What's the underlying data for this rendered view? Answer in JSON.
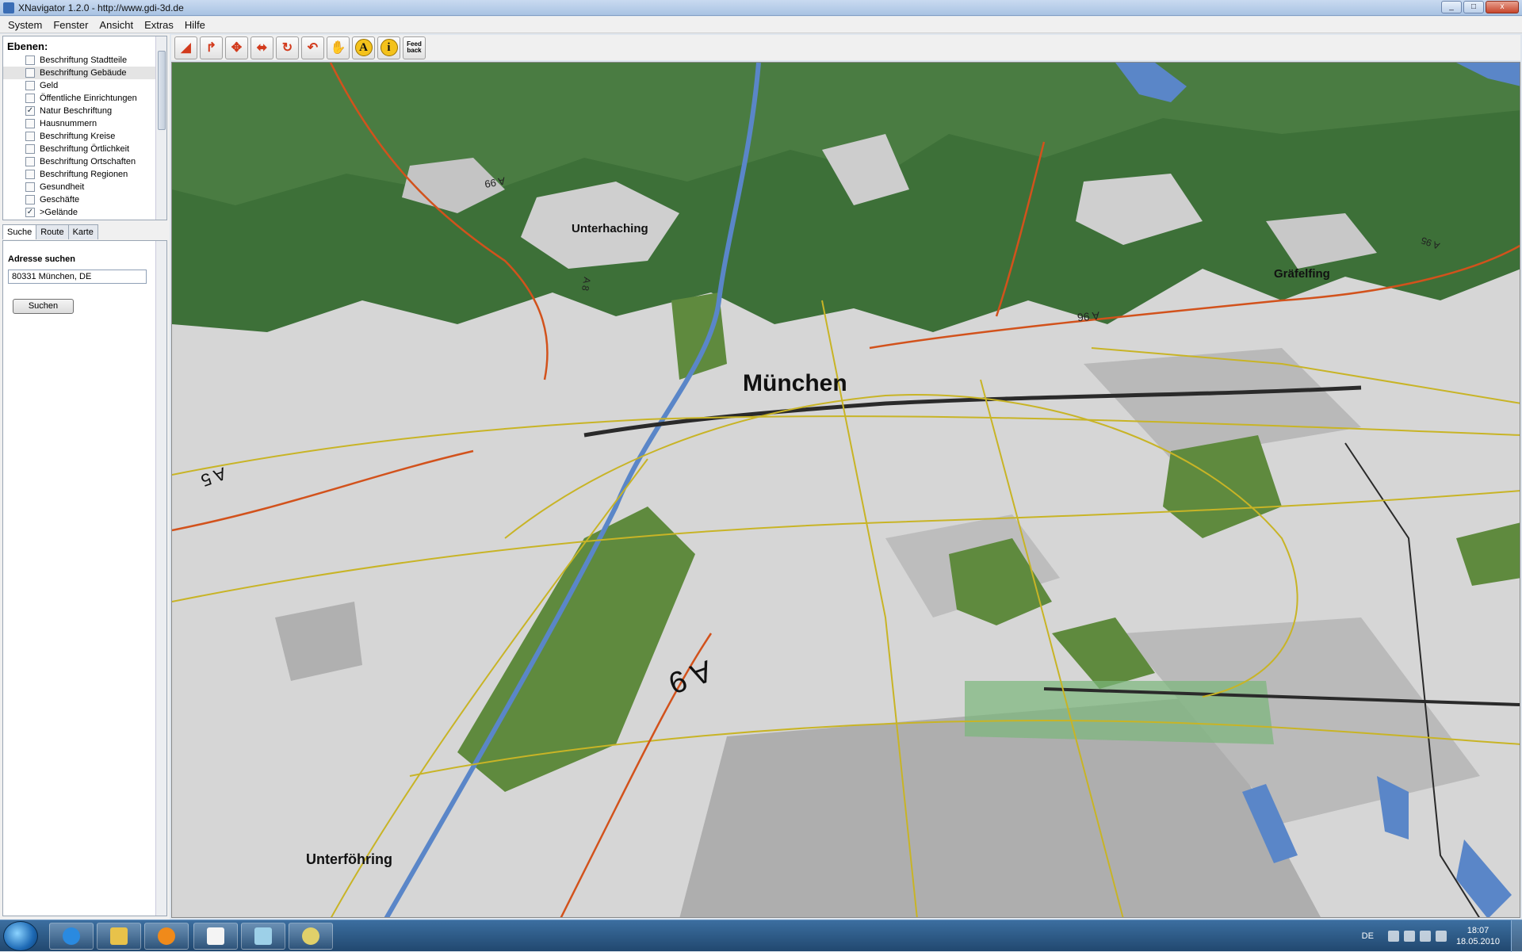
{
  "window": {
    "title": "XNavigator 1.2.0 - http://www.gdi-3d.de"
  },
  "menu": [
    "System",
    "Fenster",
    "Ansicht",
    "Extras",
    "Hilfe"
  ],
  "layers": {
    "heading": "Ebenen:",
    "items": [
      {
        "label": "Beschriftung Stadtteile",
        "checked": false
      },
      {
        "label": "Beschriftung Gebäude",
        "checked": false,
        "selected": true
      },
      {
        "label": "Geld",
        "checked": false
      },
      {
        "label": "Öffentliche Einrichtungen",
        "checked": false
      },
      {
        "label": "Natur Beschriftung",
        "checked": true
      },
      {
        "label": "Hausnummern",
        "checked": false
      },
      {
        "label": "Beschriftung Kreise",
        "checked": false
      },
      {
        "label": "Beschriftung Örtlichkeit",
        "checked": false
      },
      {
        "label": "Beschriftung Ortschaften",
        "checked": false
      },
      {
        "label": "Beschriftung Regionen",
        "checked": false
      },
      {
        "label": "Gesundheit",
        "checked": false
      },
      {
        "label": "Geschäfte",
        "checked": false
      },
      {
        "label": ">Gelände",
        "checked": true
      }
    ]
  },
  "tabs": [
    "Suche",
    "Route",
    "Karte"
  ],
  "search": {
    "label": "Adresse suchen",
    "value": "80331 München, DE",
    "button": "Suchen"
  },
  "toolbar": {
    "buttons": [
      "tilt-icon",
      "rotate-icon",
      "pan-icon",
      "move-icon",
      "reset-icon",
      "back-icon",
      "hand-icon",
      "label-icon",
      "info-icon",
      "feedback-icon"
    ],
    "label_text": "A",
    "info_text": "i",
    "feedback_text": "Feed back"
  },
  "map": {
    "labels": {
      "muenchen": "München",
      "unterhaching": "Unterhaching",
      "graefelfing": "Gräfelfing",
      "unterfoehring": "Unterföhring",
      "a99": "A 99",
      "a96": "A 96",
      "a8": "A 8",
      "a9": "A 9",
      "a95": "A 95",
      "a5": "A 5"
    },
    "colors": {
      "forest": "#3d7038",
      "park": "#5f8a3e",
      "city": "#d4d4d4",
      "built": "#a8a8a8",
      "water": "#5a86c8",
      "motorway": "#d2521c",
      "road": "#c8b426",
      "rail": "#2a2a2a"
    }
  },
  "taskbar": {
    "apps": [
      "ie-icon",
      "explorer-icon",
      "media-player-icon",
      "java-icon",
      "folder-icon",
      "paint-icon"
    ],
    "lang": "DE",
    "time": "18:07",
    "date": "18.05.2010"
  }
}
